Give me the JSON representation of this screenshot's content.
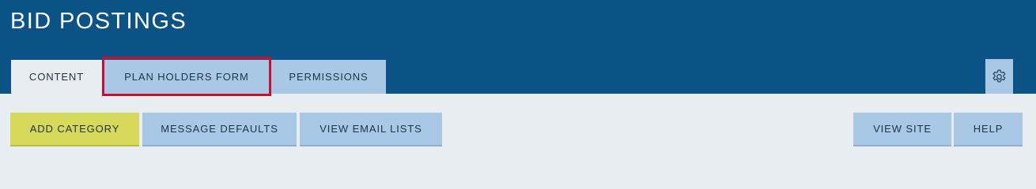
{
  "header": {
    "title": "BID POSTINGS",
    "background_color": "#0b5286"
  },
  "tabs": [
    {
      "label": "CONTENT",
      "active": true
    },
    {
      "label": "PLAN HOLDERS FORM",
      "active": false,
      "highlighted": true
    },
    {
      "label": "PERMISSIONS",
      "active": false
    }
  ],
  "settings": {
    "icon": "gear-icon"
  },
  "toolbar": {
    "left_buttons": [
      {
        "label": "ADD CATEGORY",
        "color": "#d6d95a"
      },
      {
        "label": "MESSAGE DEFAULTS",
        "color": "#a9c8e6"
      },
      {
        "label": "VIEW EMAIL LISTS",
        "color": "#a9c8e6"
      }
    ],
    "right_buttons": [
      {
        "label": "VIEW SITE",
        "color": "#a9c8e6"
      },
      {
        "label": "HELP",
        "color": "#a9c8e6"
      }
    ]
  },
  "colors": {
    "highlight_border": "#c8102e",
    "content_background": "#e8edf2"
  }
}
